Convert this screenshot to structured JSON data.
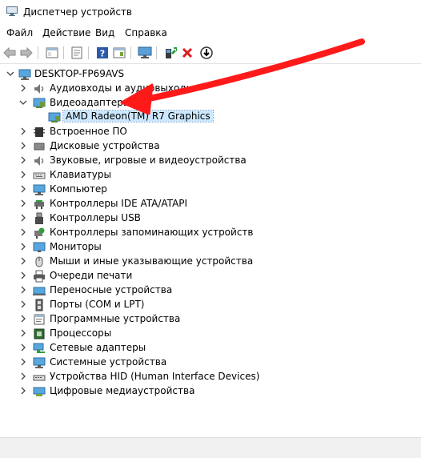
{
  "window": {
    "title": "Диспетчер устройств"
  },
  "menu": [
    "Файл",
    "Действие",
    "Вид",
    "Справка"
  ],
  "toolbar": {
    "buttons": [
      "back-icon",
      "forward-icon",
      "show-hide-console-tree-icon",
      "properties-icon",
      "help-icon",
      "action-pane-icon",
      "scan-hardware-icon",
      "update-driver-icon",
      "uninstall-icon",
      "disable-device-icon"
    ]
  },
  "tree": {
    "root": "DESKTOP-FP69AVS",
    "categories": [
      {
        "label": "Аудиовходы и аудиовыходы",
        "icon": "audio-icon"
      },
      {
        "label": "Видеоадаптеры",
        "icon": "display-adapter-icon",
        "expanded": true,
        "children": [
          {
            "label": "AMD Radeon(TM) R7 Graphics",
            "icon": "display-adapter-icon",
            "selected": true
          }
        ]
      },
      {
        "label": "Встроенное ПО",
        "icon": "firmware-icon"
      },
      {
        "label": "Дисковые устройства",
        "icon": "disk-icon"
      },
      {
        "label": "Звуковые, игровые и видеоустройства",
        "icon": "sound-icon"
      },
      {
        "label": "Клавиатуры",
        "icon": "keyboard-icon"
      },
      {
        "label": "Компьютер",
        "icon": "computer-icon"
      },
      {
        "label": "Контроллеры IDE ATA/ATAPI",
        "icon": "ide-controller-icon"
      },
      {
        "label": "Контроллеры USB",
        "icon": "usb-icon"
      },
      {
        "label": "Контроллеры запоминающих устройств",
        "icon": "storage-controller-icon"
      },
      {
        "label": "Мониторы",
        "icon": "monitor-icon"
      },
      {
        "label": "Мыши и иные указывающие устройства",
        "icon": "mouse-icon"
      },
      {
        "label": "Очереди печати",
        "icon": "printer-icon"
      },
      {
        "label": "Переносные устройства",
        "icon": "portable-device-icon"
      },
      {
        "label": "Порты (COM и LPT)",
        "icon": "port-icon"
      },
      {
        "label": "Программные устройства",
        "icon": "software-device-icon"
      },
      {
        "label": "Процессоры",
        "icon": "processor-icon"
      },
      {
        "label": "Сетевые адаптеры",
        "icon": "network-adapter-icon"
      },
      {
        "label": "Системные устройства",
        "icon": "system-device-icon"
      },
      {
        "label": "Устройства HID (Human Interface Devices)",
        "icon": "hid-icon"
      },
      {
        "label": "Цифровые медиаустройства",
        "icon": "media-device-icon"
      }
    ]
  },
  "annotation": {
    "color": "#ff1a1a"
  }
}
